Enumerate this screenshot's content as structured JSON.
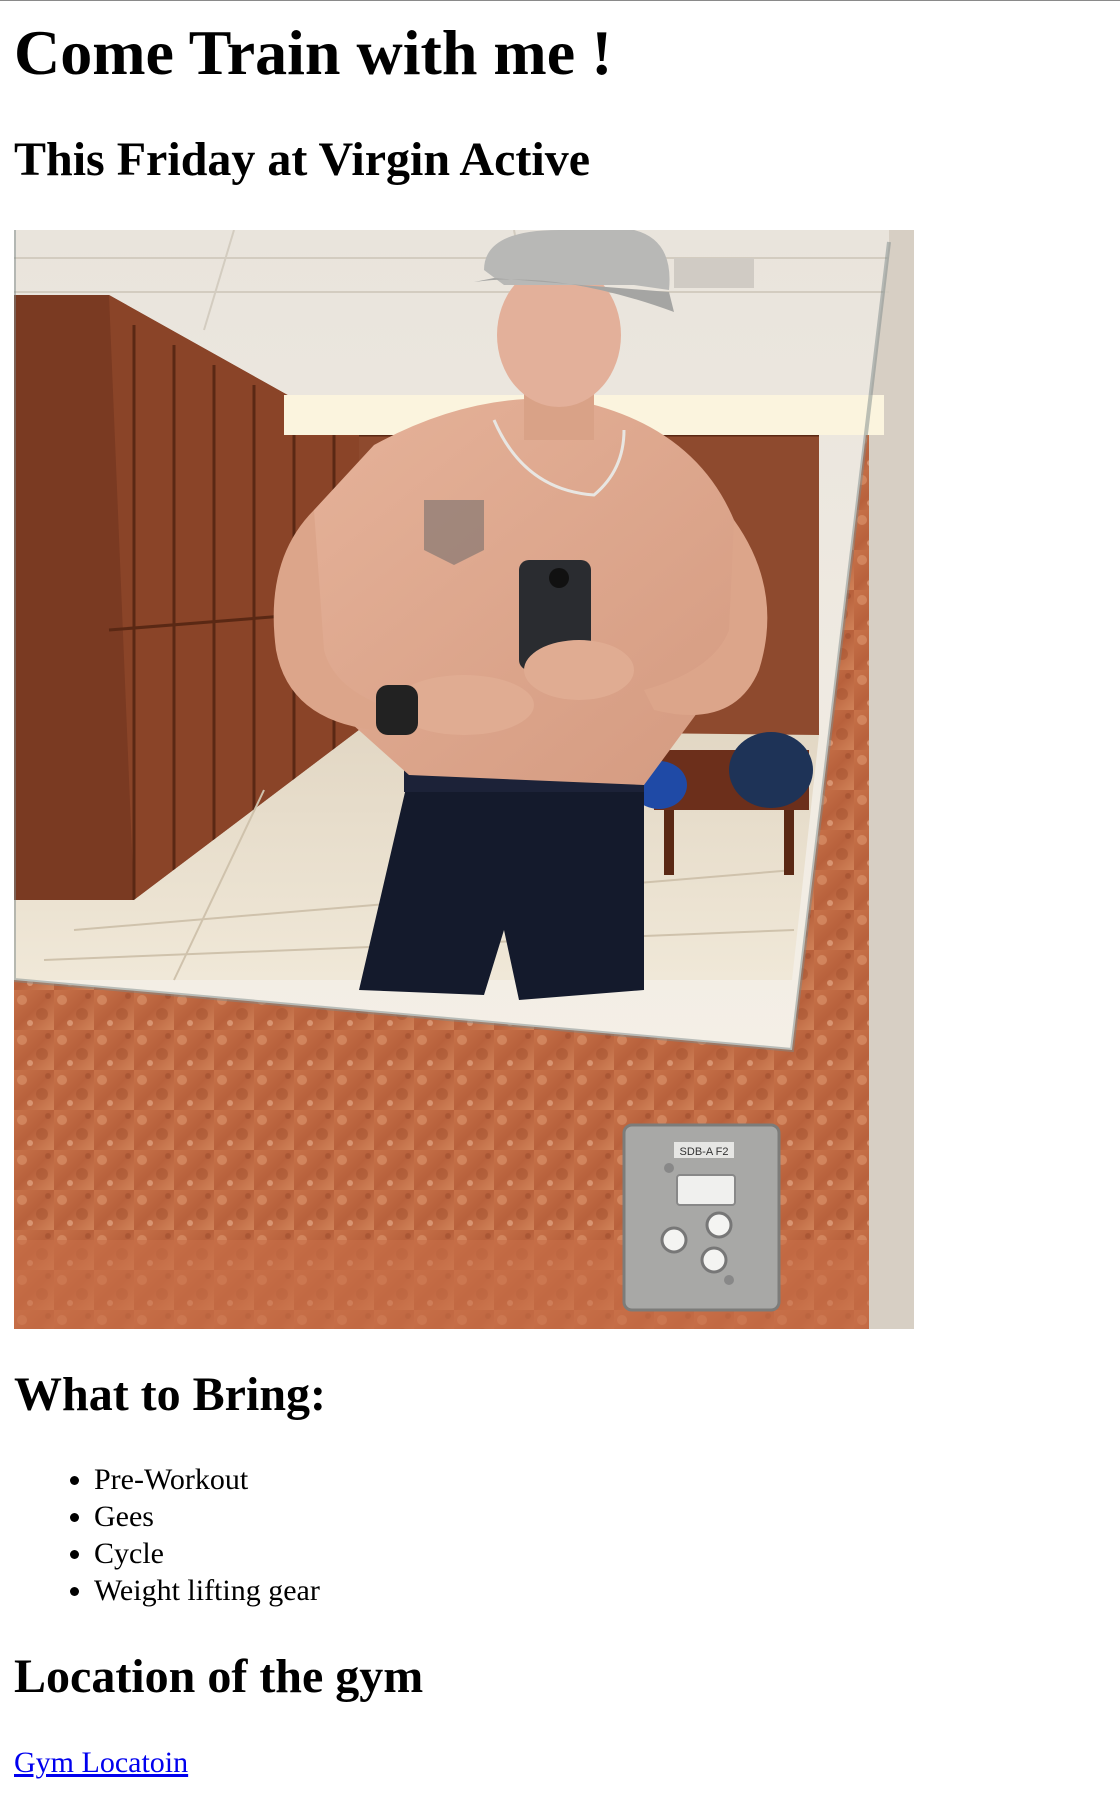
{
  "heading": "Come Train with me !",
  "subheading": "This Friday at Virgin Active",
  "photo": {
    "switch_label": "SDB-A F2"
  },
  "bring_section": {
    "title": "What to Bring:",
    "items": [
      "Pre-Workout",
      "Gees",
      "Cycle",
      "Weight lifting gear"
    ]
  },
  "location_section": {
    "title": "Location of the gym",
    "link_text": "Gym Locatoin"
  }
}
